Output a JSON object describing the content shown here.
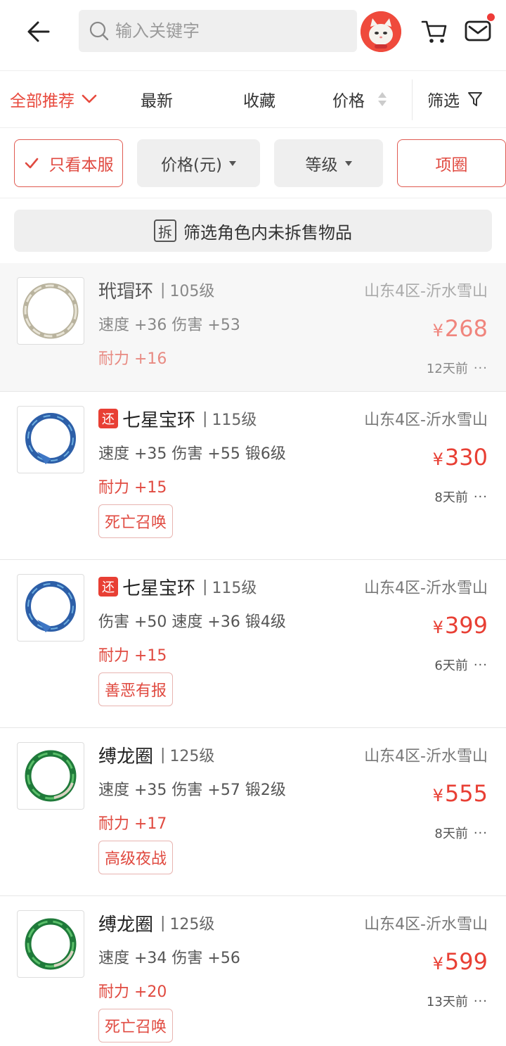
{
  "header": {
    "search_placeholder": "输入关键字"
  },
  "sort_bar": {
    "all_recommend": "全部推荐",
    "newest": "最新",
    "favorite": "收藏",
    "price": "价格",
    "filter": "筛选"
  },
  "chips": {
    "only_server": "只看本服",
    "price": "价格(元)",
    "level": "等级",
    "category": "项圈"
  },
  "unsplit": {
    "icon_char": "拆",
    "label": "筛选角色内未拆售物品"
  },
  "items": [
    {
      "name": "玳瑁环",
      "level": "105级",
      "tag": "",
      "stats": "速度 +36 伤害 +53",
      "durability": "耐力 +16",
      "skill": "",
      "server": "山东4区-沂水雪山",
      "price": "268",
      "time": "12天前"
    },
    {
      "name": "七星宝环",
      "level": "115级",
      "tag": "还",
      "stats": "速度 +35 伤害 +55 锻6级",
      "durability": "耐力 +15",
      "skill": "死亡召唤",
      "server": "山东4区-沂水雪山",
      "price": "330",
      "time": "8天前"
    },
    {
      "name": "七星宝环",
      "level": "115级",
      "tag": "还",
      "stats": "伤害 +50 速度 +36 锻4级",
      "durability": "耐力 +15",
      "skill": "善恶有报",
      "server": "山东4区-沂水雪山",
      "price": "399",
      "time": "6天前"
    },
    {
      "name": "缚龙圈",
      "level": "125级",
      "tag": "",
      "stats": "速度 +35 伤害 +57 锻2级",
      "durability": "耐力 +17",
      "skill": "高级夜战",
      "server": "山东4区-沂水雪山",
      "price": "555",
      "time": "8天前"
    },
    {
      "name": "缚龙圈",
      "level": "125级",
      "tag": "",
      "stats": "速度 +34 伤害 +56",
      "durability": "耐力 +20",
      "skill": "死亡召唤",
      "server": "山东4区-沂水雪山",
      "price": "599",
      "time": "13天前"
    }
  ],
  "currency_symbol": "¥",
  "more_glyph": "···",
  "colors": {
    "accent": "#e83f34",
    "chip_bg": "#efefef"
  }
}
